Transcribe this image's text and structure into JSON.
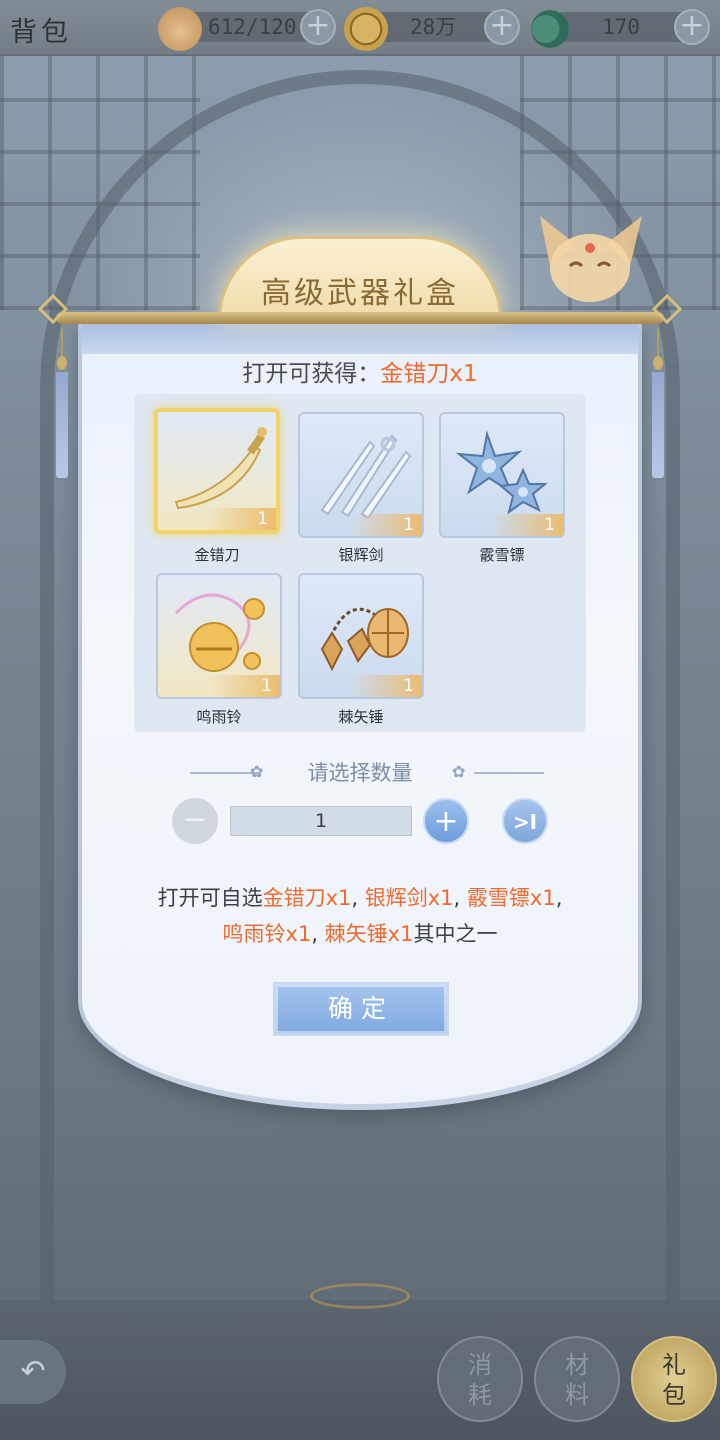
{
  "topbar": {
    "title": "背包",
    "resources": [
      {
        "icon": "cat-face-icon",
        "value": "612/120"
      },
      {
        "icon": "gold-coin-icon",
        "value": "28万"
      },
      {
        "icon": "jade-icon",
        "value": "170"
      }
    ],
    "plus": "+"
  },
  "dialog": {
    "title": "高级武器礼盒",
    "reward_prefix": "打开可获得：",
    "reward_value": "金错刀x1",
    "items": [
      {
        "name": "金错刀",
        "count": "1",
        "icon": "golden-sabre-icon",
        "selected": true
      },
      {
        "name": "银辉剑",
        "count": "1",
        "icon": "silver-swords-icon",
        "selected": false
      },
      {
        "name": "霰雪镖",
        "count": "1",
        "icon": "snow-dart-icon",
        "selected": false
      },
      {
        "name": "鸣雨铃",
        "count": "1",
        "icon": "bell-icon",
        "selected": false
      },
      {
        "name": "棘矢锤",
        "count": "1",
        "icon": "flail-hammer-icon",
        "selected": false
      }
    ],
    "quantity_label": "请选择数量",
    "quantity_value": "1",
    "minus": "−",
    "plus": "+",
    "max": ">I",
    "desc": {
      "prefix": "打开可自选",
      "opt1": "金错刀x1",
      "sep1": ", ",
      "opt2": "银辉剑x1",
      "sep2": ", ",
      "opt3": "霰雪镖x1",
      "sep3": ",",
      "opt4": "鸣雨铃x1",
      "sep4": ", ",
      "opt5": "棘矢锤x1",
      "suffix": "其中之一"
    },
    "confirm_label": "确定"
  },
  "bottom_nav": {
    "back": "↶",
    "tabs": [
      {
        "top": "消",
        "bottom": "耗",
        "active": false
      },
      {
        "top": "材",
        "bottom": "料",
        "active": false
      },
      {
        "top": "礼",
        "bottom": "包",
        "active": true
      }
    ]
  },
  "colors": {
    "highlight": "#ef6a2e",
    "accent_blue": "#7fa8e0",
    "gold": "#dcc084"
  }
}
